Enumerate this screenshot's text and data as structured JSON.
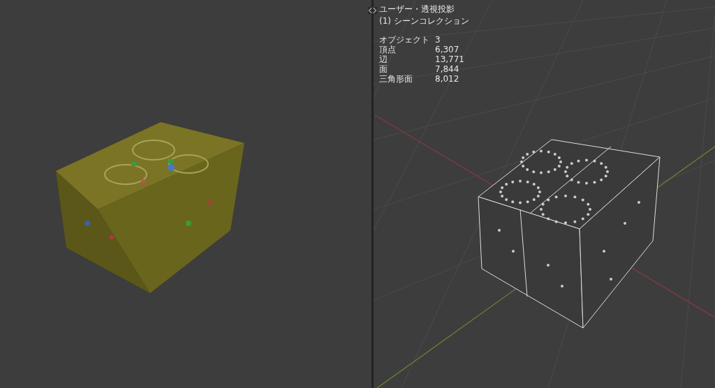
{
  "right_viewport": {
    "view_title": "ユーザー・透視投影",
    "collection": "(1) シーンコレクション",
    "stats": [
      {
        "label": "オブジェクト",
        "value": "3"
      },
      {
        "label": "頂点",
        "value": "6,307"
      },
      {
        "label": "辺",
        "value": "13,771"
      },
      {
        "label": "面",
        "value": "7,844"
      },
      {
        "label": "三角形面",
        "value": "8,012"
      }
    ]
  }
}
